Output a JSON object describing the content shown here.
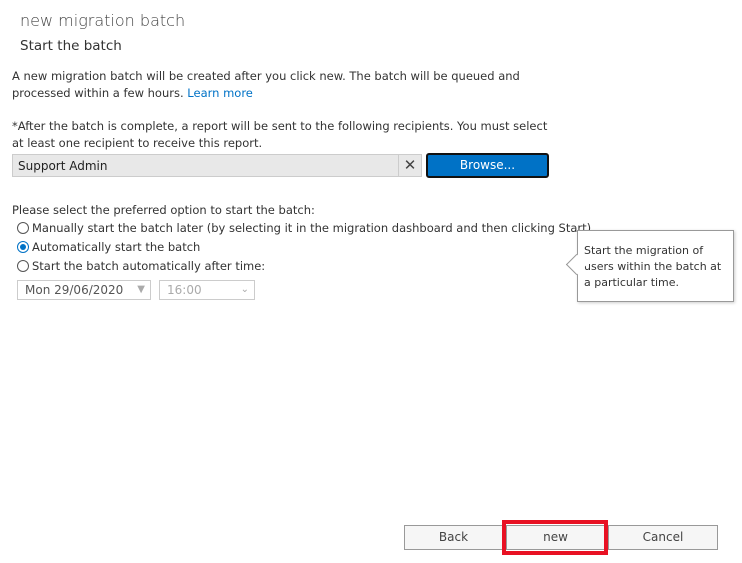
{
  "header": {
    "title": "new migration batch",
    "subtitle": "Start the batch"
  },
  "intro": {
    "text": "A new migration batch will be created after you click new. The batch will be queued and processed within a few hours. ",
    "link": "Learn more"
  },
  "recipients": {
    "text": "*After the batch is complete, a report will be sent to the following recipients. You must select at least one recipient to receive this report.",
    "value": "Support Admin",
    "clear_icon": "close-icon",
    "browse_label": "Browse..."
  },
  "start_options": {
    "prompt": "Please select the preferred option to start the batch:",
    "options": [
      {
        "label": "Manually start the batch later (by selecting it in the migration dashboard and then clicking Start)",
        "selected": false
      },
      {
        "label": "Automatically start the batch",
        "selected": true
      },
      {
        "label": "Start the batch automatically after time:",
        "selected": false
      }
    ],
    "date": "Mon 29/06/2020",
    "time": "16:00"
  },
  "tooltip": "Start the migration of users within the batch at a particular time.",
  "footer": {
    "back": "Back",
    "new": "new",
    "cancel": "Cancel"
  },
  "colors": {
    "accent": "#0072c6",
    "highlight": "#e81123"
  }
}
